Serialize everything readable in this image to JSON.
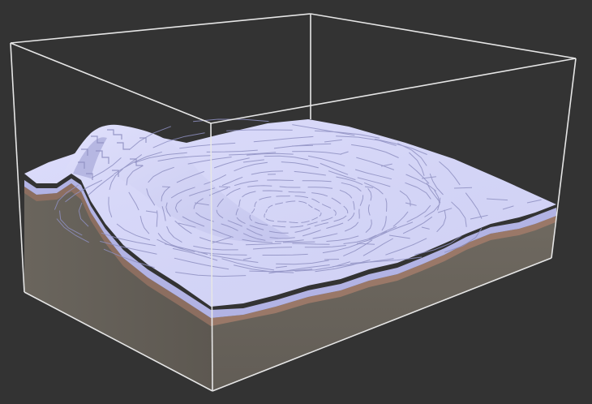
{
  "viewport": {
    "background": "#333333"
  },
  "palette": {
    "snow_light": "#d9dafa",
    "snow_mid": "#c7c8f0",
    "snow_shadow": "#9a9ccc",
    "contour": "#8f90c2",
    "soil_band": "#9a7868",
    "soil_dark": "#7f6658",
    "stone_front": "#6a645c",
    "stone_left": "#5f5a53",
    "box_line": "#e6e6e6"
  }
}
